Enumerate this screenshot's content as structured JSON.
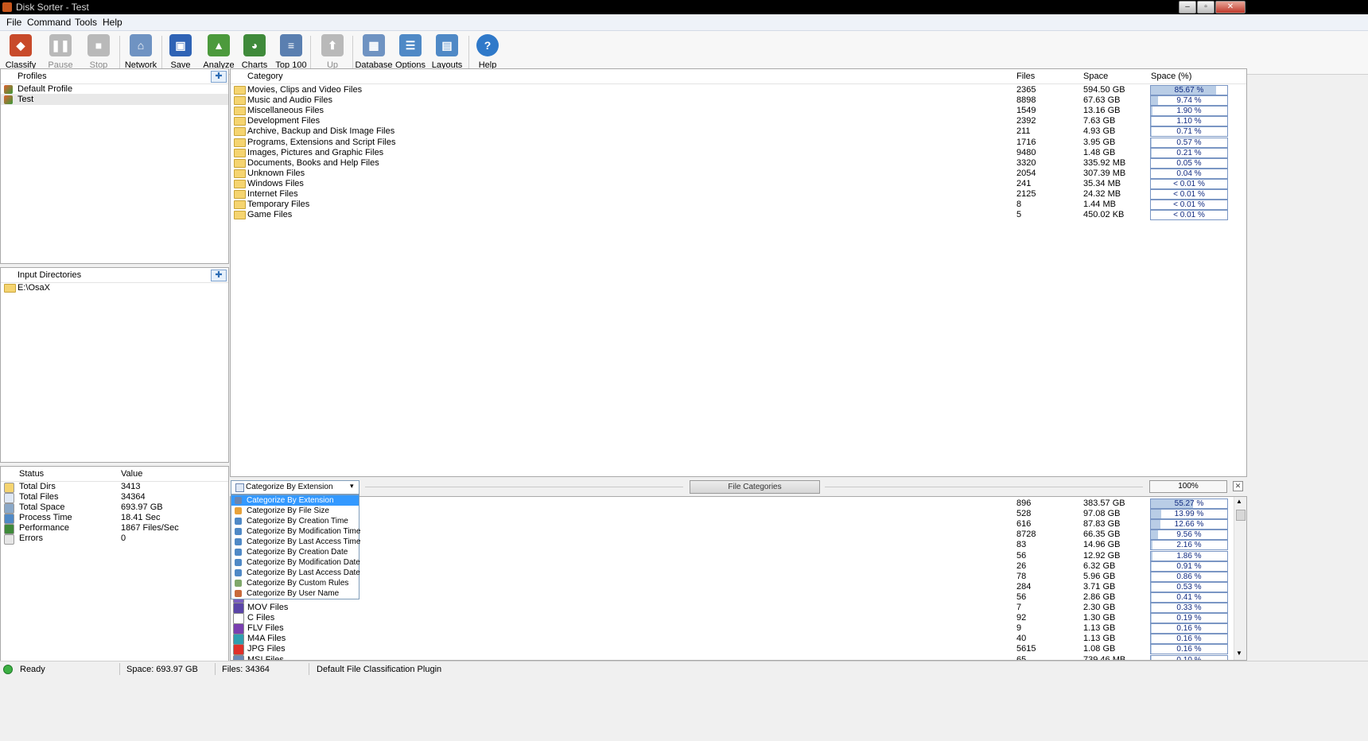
{
  "window": {
    "title": "Disk Sorter - Test"
  },
  "menu": [
    "File",
    "Command",
    "Tools",
    "Help"
  ],
  "toolbar": [
    {
      "label": "Classify",
      "icon": "classify-icon",
      "color": "#c84a2a",
      "enabled": true
    },
    {
      "label": "Pause",
      "icon": "pause-icon",
      "color": "#b9b9b9",
      "enabled": false
    },
    {
      "label": "Stop",
      "icon": "stop-icon",
      "color": "#b9b9b9",
      "enabled": false
    },
    {
      "label": "Network",
      "icon": "network-icon",
      "color": "#6f93c2",
      "enabled": true
    },
    {
      "label": "Save",
      "icon": "save-icon",
      "color": "#2f63b5",
      "enabled": true
    },
    {
      "label": "Analyze",
      "icon": "analyze-icon",
      "color": "#4c9a3c",
      "enabled": true
    },
    {
      "label": "Charts",
      "icon": "charts-icon",
      "color": "#3f8a3a",
      "enabled": true
    },
    {
      "label": "Top 100",
      "icon": "top100-icon",
      "color": "#5a7fb0",
      "enabled": true
    },
    {
      "label": "Up",
      "icon": "up-arrow-icon",
      "color": "#b9b9b9",
      "enabled": false
    },
    {
      "label": "Database",
      "icon": "database-icon",
      "color": "#6f93c2",
      "enabled": true
    },
    {
      "label": "Options",
      "icon": "options-icon",
      "color": "#4f89c6",
      "enabled": true
    },
    {
      "label": "Layouts",
      "icon": "layouts-icon",
      "color": "#4f89c6",
      "enabled": true
    },
    {
      "label": "Help",
      "icon": "help-icon",
      "color": "#2f79c9",
      "enabled": true
    }
  ],
  "profiles": {
    "header": "Profiles",
    "items": [
      {
        "label": "Default Profile",
        "selected": false
      },
      {
        "label": "Test",
        "selected": true
      }
    ]
  },
  "input_dirs": {
    "header": "Input Directories",
    "items": [
      "E:\\OsaX"
    ]
  },
  "status_panel": {
    "headers": [
      "Status",
      "Value"
    ],
    "rows": [
      {
        "label": "Total Dirs",
        "value": "3413",
        "icon": "folder-icon"
      },
      {
        "label": "Total Files",
        "value": "34364",
        "icon": "file-icon"
      },
      {
        "label": "Total Space",
        "value": "693.97 GB",
        "icon": "disk-icon"
      },
      {
        "label": "Process Time",
        "value": "18.41 Sec",
        "icon": "clock-icon"
      },
      {
        "label": "Performance",
        "value": "1867 Files/Sec",
        "icon": "performance-icon"
      },
      {
        "label": "Errors",
        "value": "0",
        "icon": "errors-icon"
      }
    ]
  },
  "categories_table": {
    "headers": [
      "Category",
      "Files",
      "Space",
      "Space (%)"
    ],
    "rows": [
      {
        "name": "Movies, Clips and Video Files",
        "files": "2365",
        "space": "594.50 GB",
        "pct": "85.67 %",
        "frac": 0.8567
      },
      {
        "name": "Music and Audio Files",
        "files": "8898",
        "space": "67.63 GB",
        "pct": "9.74 %",
        "frac": 0.0974
      },
      {
        "name": "Miscellaneous Files",
        "files": "1549",
        "space": "13.16 GB",
        "pct": "1.90 %",
        "frac": 0.019
      },
      {
        "name": "Development Files",
        "files": "2392",
        "space": "7.63 GB",
        "pct": "1.10 %",
        "frac": 0.011
      },
      {
        "name": "Archive, Backup and Disk Image Files",
        "files": "211",
        "space": "4.93 GB",
        "pct": "0.71 %",
        "frac": 0.0071
      },
      {
        "name": "Programs, Extensions and Script Files",
        "files": "1716",
        "space": "3.95 GB",
        "pct": "0.57 %",
        "frac": 0.0057
      },
      {
        "name": "Images, Pictures and Graphic Files",
        "files": "9480",
        "space": "1.48 GB",
        "pct": "0.21 %",
        "frac": 0.0021
      },
      {
        "name": "Documents, Books and Help Files",
        "files": "3320",
        "space": "335.92 MB",
        "pct": "0.05 %",
        "frac": 0.0005
      },
      {
        "name": "Unknown Files",
        "files": "2054",
        "space": "307.39 MB",
        "pct": "0.04 %",
        "frac": 0.0004
      },
      {
        "name": "Windows Files",
        "files": "241",
        "space": "35.34 MB",
        "pct": "< 0.01 %",
        "frac": 0
      },
      {
        "name": "Internet Files",
        "files": "2125",
        "space": "24.32 MB",
        "pct": "< 0.01 %",
        "frac": 0
      },
      {
        "name": "Temporary Files",
        "files": "8",
        "space": "1.44 MB",
        "pct": "< 0.01 %",
        "frac": 0
      },
      {
        "name": "Game Files",
        "files": "5",
        "space": "450.02 KB",
        "pct": "< 0.01 %",
        "frac": 0
      }
    ]
  },
  "bottom_toolbar": {
    "selected": "Categorize By Extension",
    "center_button": "File Categories",
    "zoom": "100%",
    "options": [
      "Categorize By Extension",
      "Categorize By File Size",
      "Categorize By Creation Time",
      "Categorize By Modification Time",
      "Categorize By Last Access Time",
      "Categorize By Creation Date",
      "Categorize By Modification Date",
      "Categorize By Last Access Date",
      "Categorize By Custom Rules",
      "Categorize By User Name"
    ]
  },
  "extension_table": {
    "rows": [
      {
        "name": "",
        "files": "896",
        "space": "383.57 GB",
        "pct": "55.27 %",
        "frac": 0.5527,
        "color": "#7a5fc0"
      },
      {
        "name": "",
        "files": "528",
        "space": "97.08 GB",
        "pct": "13.99 %",
        "frac": 0.1399,
        "color": "#7a5fc0"
      },
      {
        "name": "",
        "files": "616",
        "space": "87.83 GB",
        "pct": "12.66 %",
        "frac": 0.1266,
        "color": "#7a5fc0"
      },
      {
        "name": "",
        "files": "8728",
        "space": "66.35 GB",
        "pct": "9.56 %",
        "frac": 0.0956,
        "color": "#d97b2b"
      },
      {
        "name": "",
        "files": "83",
        "space": "14.96 GB",
        "pct": "2.16 %",
        "frac": 0.0216,
        "color": "#7a5fc0"
      },
      {
        "name": "",
        "files": "56",
        "space": "12.92 GB",
        "pct": "1.86 %",
        "frac": 0.0186,
        "color": "#7a5fc0"
      },
      {
        "name": "",
        "files": "26",
        "space": "6.32 GB",
        "pct": "0.91 %",
        "frac": 0.0091,
        "color": "#d97b2b"
      },
      {
        "name": "",
        "files": "78",
        "space": "5.96 GB",
        "pct": "0.86 %",
        "frac": 0.0086,
        "color": "#d97b2b"
      },
      {
        "name": "",
        "files": "284",
        "space": "3.71 GB",
        "pct": "0.53 %",
        "frac": 0.0053,
        "color": "#7a5fc0"
      },
      {
        "name": "",
        "files": "56",
        "space": "2.86 GB",
        "pct": "0.41 %",
        "frac": 0.0041,
        "color": "#7a5fc0"
      },
      {
        "name": "MOV Files",
        "files": "7",
        "space": "2.30 GB",
        "pct": "0.33 %",
        "frac": 0.0033,
        "color": "#5b45a8"
      },
      {
        "name": "C Files",
        "files": "92",
        "space": "1.30 GB",
        "pct": "0.19 %",
        "frac": 0.0019,
        "color": "#ffffff"
      },
      {
        "name": "FLV Files",
        "files": "9",
        "space": "1.13 GB",
        "pct": "0.16 %",
        "frac": 0.0016,
        "color": "#7a3fb0"
      },
      {
        "name": "M4A Files",
        "files": "40",
        "space": "1.13 GB",
        "pct": "0.16 %",
        "frac": 0.0016,
        "color": "#2f9fb0"
      },
      {
        "name": "JPG Files",
        "files": "5615",
        "space": "1.08 GB",
        "pct": "0.16 %",
        "frac": 0.0016,
        "color": "#e0302a"
      },
      {
        "name": "MSI Files",
        "files": "65",
        "space": "739.46 MB",
        "pct": "0.10 %",
        "frac": 0.001,
        "color": "#6a8ab8"
      }
    ]
  },
  "statusbar": {
    "state": "Ready",
    "space": "Space: 693.97 GB",
    "files": "Files: 34364",
    "plugin": "Default File Classification Plugin"
  }
}
